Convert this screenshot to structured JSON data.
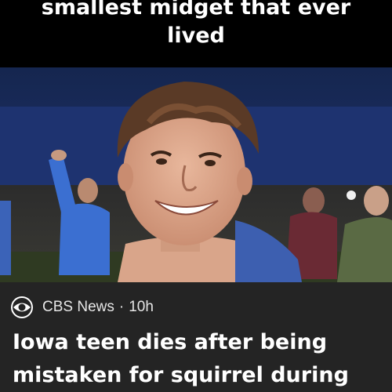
{
  "meme": {
    "caption": "smallest midget that ever lived"
  },
  "photo": {
    "alt_icon": "photo-of-smiling-teen"
  },
  "news_card": {
    "source": "CBS News",
    "separator": "·",
    "time": "10h",
    "headline": "Iowa teen dies after being mistaken for squirrel during",
    "logo_icon": "cbs-eye-logo-icon"
  },
  "colors": {
    "background": "#000000",
    "card_background": "#242424",
    "text": "#ffffff"
  }
}
